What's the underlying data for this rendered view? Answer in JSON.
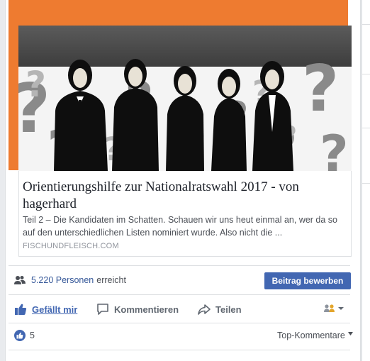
{
  "link_card": {
    "title": "Orientierungshilfe zur Nationalratswahl 2017 - von hagerhard",
    "description": "Teil 2 – Die Kandidaten im Schatten. Schauen wir uns heut einmal an, wer da so auf den unterschiedlichen Listen nominiert wurde. Also nicht die ...",
    "domain": "FISCHUNDFLEISCH.COM",
    "image_alt": "Five silhouetted figures in Guy-Fawkes masks in front of grey question marks"
  },
  "reach": {
    "count": "5.220 Personen",
    "suffix": "erreicht"
  },
  "boost_button": "Beitrag bewerben",
  "actions": {
    "like": "Gefällt mir",
    "comment": "Kommentieren",
    "share": "Teilen"
  },
  "reactions": {
    "count": "5"
  },
  "comments_sort": "Top-Kommentare",
  "colors": {
    "brand_blue": "#4267b2",
    "link_blue": "#365899",
    "frame_orange": "#ee7b30"
  }
}
